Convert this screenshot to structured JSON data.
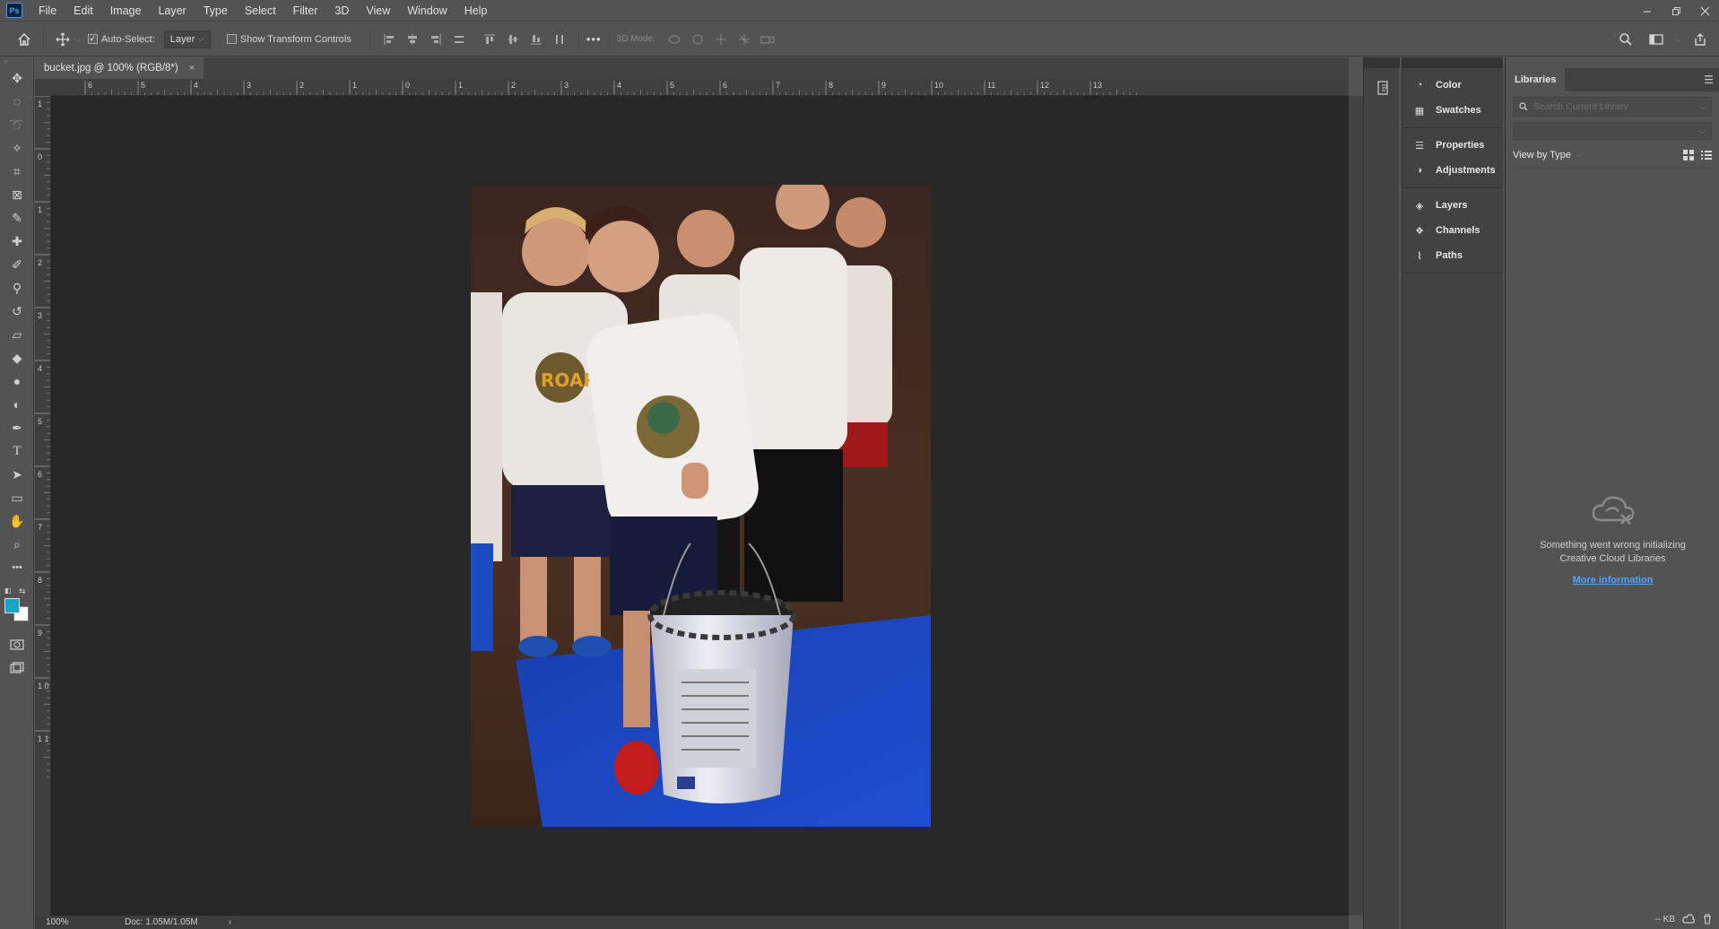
{
  "app": {
    "logo_text": "Ps"
  },
  "menu": [
    "File",
    "Edit",
    "Image",
    "Layer",
    "Type",
    "Select",
    "Filter",
    "3D",
    "View",
    "Window",
    "Help"
  ],
  "options": {
    "auto_select_label": "Auto-Select:",
    "auto_select_checked": true,
    "auto_select_target": "Layer",
    "show_transform_label": "Show Transform Controls",
    "mode_3d_label": "3D Mode:",
    "more_label": "•••"
  },
  "document": {
    "tab_title": "bucket.jpg @ 100% (RGB/8*)",
    "close_glyph": "×",
    "zoom": "100%",
    "doc_size": "Doc: 1.05M/1.05M",
    "status_arrow": "›"
  },
  "ruler_h_labels": [
    "6",
    "5",
    "4",
    "3",
    "2",
    "1",
    "0",
    "1",
    "2",
    "3",
    "4",
    "5",
    "6",
    "7",
    "8",
    "9",
    "10",
    "11",
    "12",
    "13"
  ],
  "ruler_v_labels": [
    "1",
    "0",
    "1",
    "2",
    "3",
    "4",
    "5",
    "6",
    "7",
    "8",
    "9",
    "1\n0",
    "1\n1"
  ],
  "tools": [
    {
      "name": "move-tool-icon",
      "glyph": "✥"
    },
    {
      "name": "marquee-tool-icon",
      "glyph": "◌"
    },
    {
      "name": "lasso-tool-icon",
      "glyph": "➰"
    },
    {
      "name": "magic-wand-tool-icon",
      "glyph": "✧"
    },
    {
      "name": "crop-tool-icon",
      "glyph": "⌗"
    },
    {
      "name": "frame-tool-icon",
      "glyph": "⊠"
    },
    {
      "name": "eyedropper-tool-icon",
      "glyph": "✎"
    },
    {
      "name": "healing-brush-tool-icon",
      "glyph": "✚"
    },
    {
      "name": "brush-tool-icon",
      "glyph": "✐"
    },
    {
      "name": "clone-stamp-tool-icon",
      "glyph": "⚲"
    },
    {
      "name": "history-brush-tool-icon",
      "glyph": "↺"
    },
    {
      "name": "eraser-tool-icon",
      "glyph": "▱"
    },
    {
      "name": "paint-bucket-tool-icon",
      "glyph": "◆"
    },
    {
      "name": "blur-tool-icon",
      "glyph": "●"
    },
    {
      "name": "dodge-tool-icon",
      "glyph": "◐"
    },
    {
      "name": "pen-tool-icon",
      "glyph": "✒"
    },
    {
      "name": "type-tool-icon",
      "glyph": "T"
    },
    {
      "name": "path-selection-tool-icon",
      "glyph": "➤"
    },
    {
      "name": "rectangle-tool-icon",
      "glyph": "▭"
    },
    {
      "name": "hand-tool-icon",
      "glyph": "✋"
    },
    {
      "name": "zoom-tool-icon",
      "glyph": "⌕"
    },
    {
      "name": "edit-toolbar-icon",
      "glyph": "•••"
    }
  ],
  "colors": {
    "foreground": "#1aa3c4",
    "background": "#ffffff",
    "link": "#4ea4ff"
  },
  "panels": {
    "group1": [
      {
        "icon": "color-panel-icon",
        "glyph": "◔",
        "label": "Color"
      },
      {
        "icon": "swatches-panel-icon",
        "glyph": "▦",
        "label": "Swatches"
      }
    ],
    "group2": [
      {
        "icon": "properties-panel-icon",
        "glyph": "☰",
        "label": "Properties"
      },
      {
        "icon": "adjustments-panel-icon",
        "glyph": "◑",
        "label": "Adjustments"
      }
    ],
    "group3": [
      {
        "icon": "layers-panel-icon",
        "glyph": "◈",
        "label": "Layers"
      },
      {
        "icon": "channels-panel-icon",
        "glyph": "❖",
        "label": "Channels"
      },
      {
        "icon": "paths-panel-icon",
        "glyph": "⌇",
        "label": "Paths"
      }
    ]
  },
  "libraries": {
    "tab_label": "Libraries",
    "search_placeholder": "Search Current Library",
    "view_by": "View by Type",
    "error_line1": "Something went wrong initializing",
    "error_line2": "Creative Cloud Libraries",
    "more_info": "More information",
    "footer_kb": "-- KB"
  }
}
